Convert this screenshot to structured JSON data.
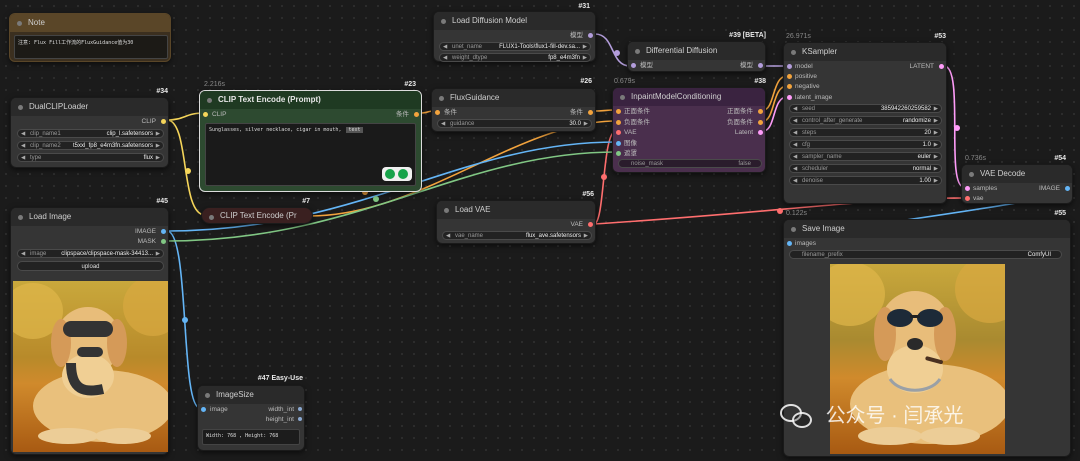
{
  "colors": {
    "clip": "#f5d55a",
    "conditioning": "#f2a33d",
    "model": "#b39ddb",
    "latent": "#ff9cf9",
    "vae": "#ff6e6e",
    "image": "#64b5f6",
    "mask": "#81c784",
    "int": "#8aa8d0"
  },
  "note": {
    "title": "Note",
    "text": "注意: Flux Fill工作流的FluxGuidance值为30"
  },
  "dualclip": {
    "id": "#34",
    "title": "DualCLIPLoader",
    "out_clip": "CLIP",
    "clip_name1_label": "clip_name1",
    "clip_name1": "clip_l.safetensors",
    "clip_name2_label": "clip_name2",
    "clip_name2": "t5xxl_fp8_e4m3fn.safetensors",
    "type_label": "type",
    "type": "flux"
  },
  "clip_encode_23": {
    "id": "#23",
    "timing": "2.216s",
    "title": "CLIP Text Encode (Prompt)",
    "in_clip": "CLIP",
    "out_cond": "条件",
    "text": "Sunglasses, silver necklace, cigar in mouth,",
    "tag": "text"
  },
  "clip_encode_7": {
    "id": "#7",
    "title": "CLIP Text Encode (Pr"
  },
  "load_image": {
    "id": "#45",
    "title": "Load Image",
    "out_image": "IMAGE",
    "out_mask": "MASK",
    "image_label": "image",
    "image": "clipspace/clipspace-mask-34413...",
    "upload": "upload"
  },
  "image_size": {
    "id": "#47 Easy-Use",
    "title": "ImageSize",
    "in_image": "image",
    "out_width": "width_int",
    "out_height": "height_int",
    "text": "Width: 768 , Height: 768"
  },
  "diffusion": {
    "id": "#31",
    "title": "Load Diffusion Model",
    "out_model": "模型",
    "unet_label": "unet_name",
    "unet": "FLUX1-Tools\\flux1-fill-dev.sa...",
    "dtype_label": "weight_dtype",
    "dtype": "fp8_e4m3fn"
  },
  "flux_guidance": {
    "id": "#26",
    "title": "FluxGuidance",
    "in_cond": "条件",
    "out_cond": "条件",
    "guidance_label": "guidance",
    "guidance": "30.0"
  },
  "diff_diffusion": {
    "id": "#39 [BETA]",
    "title": "Differential Diffusion",
    "in_model": "模型",
    "out_model": "模型"
  },
  "inpaint": {
    "id": "#38",
    "timing": "0.679s",
    "title": "InpaintModelConditioning",
    "in_pos": "正面条件",
    "in_neg": "负面条件",
    "in_vae": "VAE",
    "in_pixels": "图像",
    "in_mask": "遮罩",
    "out_pos": "正面条件",
    "out_neg": "负面条件",
    "out_latent": "Latent",
    "noise_mask_label": "noise_mask",
    "noise_mask": "false"
  },
  "ksampler": {
    "id": "#53",
    "timing": "26.971s",
    "title": "KSampler",
    "in_model": "model",
    "in_pos": "positive",
    "in_neg": "negative",
    "in_latent": "latent_image",
    "out_latent": "LATENT",
    "widgets": [
      {
        "label": "seed",
        "value": "385942260259582"
      },
      {
        "label": "control_after_generate",
        "value": "randomize"
      },
      {
        "label": "steps",
        "value": "20"
      },
      {
        "label": "cfg",
        "value": "1.0"
      },
      {
        "label": "sampler_name",
        "value": "euler"
      },
      {
        "label": "scheduler",
        "value": "normal"
      },
      {
        "label": "denoise",
        "value": "1.00"
      }
    ]
  },
  "load_vae": {
    "id": "#56",
    "title": "Load VAE",
    "out_vae": "VAE",
    "vae_label": "vae_name",
    "vae": "flux_ave.safetensors"
  },
  "vae_decode": {
    "id": "#54",
    "timing": "0.736s",
    "title": "VAE Decode",
    "in_samples": "samples",
    "in_vae": "vae",
    "out_image": "IMAGE"
  },
  "save_image": {
    "id": "#55",
    "timing": "0.122s",
    "title": "Save Image",
    "in_images": "images",
    "prefix_label": "filename_prefix",
    "prefix": "ComfyUI"
  },
  "watermark": {
    "text": "公众号 · 闫承光"
  }
}
